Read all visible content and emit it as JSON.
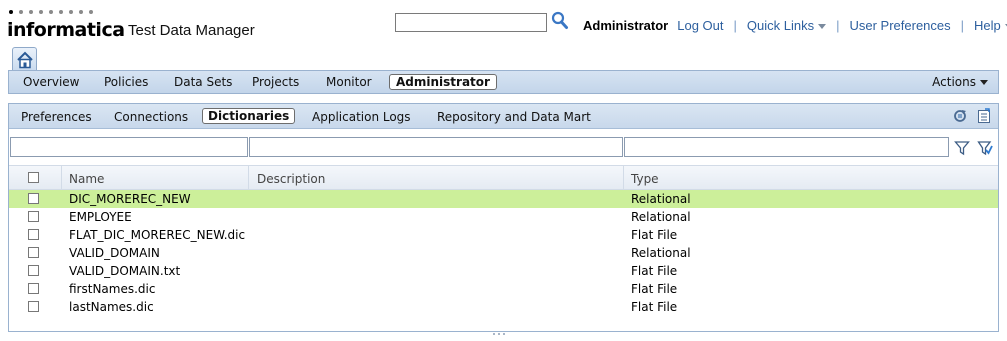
{
  "header": {
    "logo_text": "informatica",
    "product_name": "Test Data Manager",
    "search": {
      "value": "",
      "placeholder": ""
    },
    "user": "Administrator",
    "links": {
      "logout": "Log Out",
      "quick_links": "Quick Links",
      "user_preferences": "User Preferences",
      "help": "Help"
    }
  },
  "main_nav": {
    "items": [
      "Overview",
      "Policies",
      "Data Sets",
      "Projects",
      "Monitor",
      "Administrator"
    ],
    "active": "Administrator",
    "actions_label": "Actions"
  },
  "sub_nav": {
    "items": [
      "Preferences",
      "Connections",
      "Dictionaries",
      "Application Logs",
      "Repository and Data Mart"
    ],
    "active": "Dictionaries"
  },
  "filters": {
    "name": "",
    "description": "",
    "type": ""
  },
  "table": {
    "columns": [
      "Name",
      "Description",
      "Type"
    ],
    "rows": [
      {
        "name": "DIC_MOREREC_NEW",
        "description": "",
        "type": "Relational",
        "selected": true
      },
      {
        "name": "EMPLOYEE",
        "description": "",
        "type": "Relational",
        "selected": false
      },
      {
        "name": "FLAT_DIC_MOREREC_NEW.dic",
        "description": "",
        "type": "Flat File",
        "selected": false
      },
      {
        "name": "VALID_DOMAIN",
        "description": "",
        "type": "Relational",
        "selected": false
      },
      {
        "name": "VALID_DOMAIN.txt",
        "description": "",
        "type": "Flat File",
        "selected": false
      },
      {
        "name": "firstNames.dic",
        "description": "",
        "type": "Flat File",
        "selected": false
      },
      {
        "name": "lastNames.dic",
        "description": "",
        "type": "Flat File",
        "selected": false
      }
    ]
  },
  "colors": {
    "nav_bg": "#c9d9ec",
    "link": "#2d5f9e",
    "selected_row": "#ccef9a"
  }
}
